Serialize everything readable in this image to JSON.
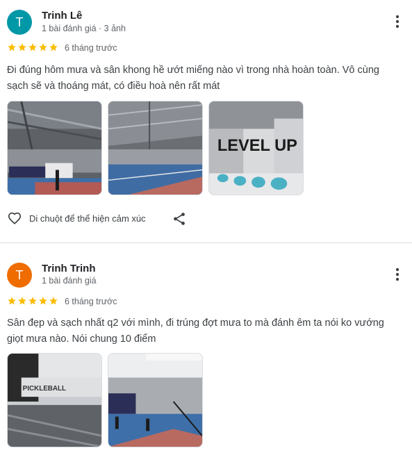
{
  "colors": {
    "avatar_1": "#0097a7",
    "avatar_2": "#ef6c00",
    "star": "#fbbc04"
  },
  "reviews": [
    {
      "initial": "T",
      "name": "Trinh Lê",
      "meta": "1 bài đánh giá · 3 ảnh",
      "rating": 5,
      "time": "6 tháng trước",
      "text": "Đi đúng hôm mưa và sân khong hề ướt miếng nào vì trong nhà hoàn toàn. Vô cùng sạch sẽ và thoáng mát, có điều hoà nên rất mát",
      "photo_sign_text": "LEVEL UP",
      "react_label": "Di chuột để thể hiện cảm xúc",
      "icons": {
        "more": "more-vert-icon",
        "heart": "heart-outline-icon",
        "share": "share-icon",
        "star": "star-icon"
      }
    },
    {
      "initial": "T",
      "name": "Trinh Trinh",
      "meta": "1 bài đánh giá",
      "rating": 5,
      "time": "6 tháng trước",
      "text": "Sân đẹp và sạch nhất q2 với mình, đi trúng đợt mưa to mà đánh êm ta nói ko vướng giọt mưa nào. Nói chung 10 điểm",
      "photo_sign_text": "PICKLEBALL"
    }
  ]
}
